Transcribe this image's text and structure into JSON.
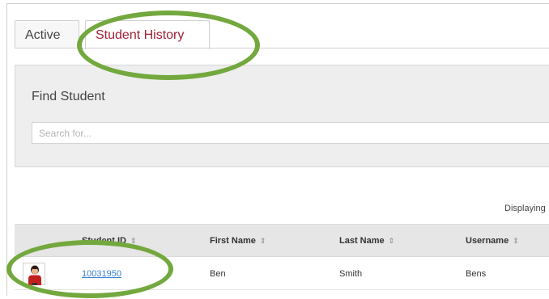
{
  "tabs": [
    {
      "label": "Active"
    },
    {
      "label": "Student History"
    }
  ],
  "find_student": {
    "title": "Find Student",
    "search_placeholder": "Search for..."
  },
  "displaying_text": "Displaying",
  "table": {
    "columns": [
      "Student ID",
      "First Name",
      "Last Name",
      "Username"
    ],
    "sort_glyph": "⇕",
    "rows": [
      {
        "student_id": "10031950",
        "first_name": "Ben",
        "last_name": "Smith",
        "username": "Bens"
      }
    ]
  },
  "colors": {
    "active_tab_text": "#a31f34",
    "annotation_green": "#73a83e",
    "link_blue": "#3a7fd0"
  },
  "icons": {
    "avatar": "student-avatar-icon",
    "sort": "sort-icon"
  }
}
